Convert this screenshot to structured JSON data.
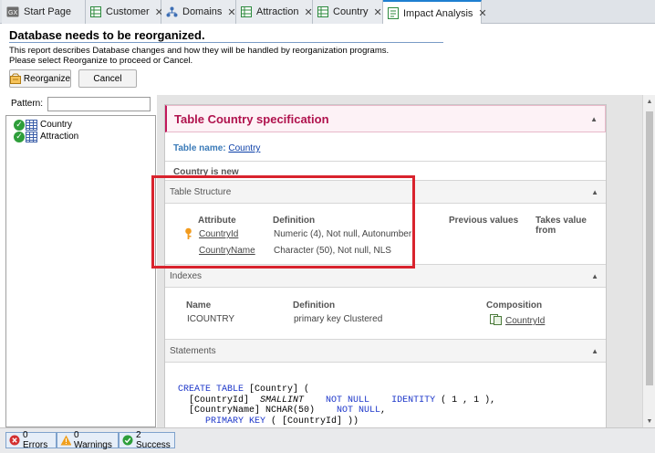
{
  "tabs": [
    {
      "label": "Start Page",
      "icon": "start-page-icon",
      "active": false
    },
    {
      "label": "Customer",
      "icon": "transaction-icon",
      "active": false
    },
    {
      "label": "Domains",
      "icon": "domains-icon",
      "active": false
    },
    {
      "label": "Attraction",
      "icon": "transaction-icon",
      "active": false
    },
    {
      "label": "Country",
      "icon": "transaction-icon",
      "active": false
    },
    {
      "label": "Impact Analysis",
      "icon": "impact-analysis-icon",
      "active": true
    }
  ],
  "header": {
    "title": "Database needs to be reorganized.",
    "desc_line1": "This report describes Database changes and how they will be handled by reorganization programs.",
    "desc_line2": "Please select Reorganize to proceed or Cancel.",
    "reorganize_label": "Reorganize",
    "cancel_label": "Cancel"
  },
  "left": {
    "pattern_label": "Pattern:",
    "pattern_value": "",
    "items": [
      "Country",
      "Attraction"
    ]
  },
  "spec": {
    "title": "Table Country specification",
    "table_name_label": "Table name:",
    "table_name": "Country",
    "status": "Country is new",
    "structure": {
      "title": "Table Structure",
      "headers": {
        "attribute": "Attribute",
        "definition": "Definition",
        "previous": "Previous values",
        "takes": "Takes value from"
      },
      "rows": [
        {
          "attribute": "CountryId",
          "definition": "Numeric (4), Not null, Autonumber",
          "key": true
        },
        {
          "attribute": "CountryName",
          "definition": "Character (50), Not null, NLS",
          "key": false
        }
      ]
    },
    "indexes": {
      "title": "Indexes",
      "headers": {
        "name": "Name",
        "definition": "Definition",
        "composition": "Composition"
      },
      "rows": [
        {
          "name": "ICOUNTRY",
          "definition": "primary key Clustered",
          "composition": "CountryId"
        }
      ]
    },
    "statements": {
      "title": "Statements",
      "lines": [
        "CREATE TABLE [Country] (",
        "  [CountryId]  SMALLINT    NOT NULL    IDENTITY ( 1 , 1 ),",
        "  [CountryName] NCHAR(50)    NOT NULL,",
        "     PRIMARY KEY ( [CountryId] ))"
      ]
    }
  },
  "status": {
    "errors": "0 Errors",
    "warnings": "0 Warnings",
    "success": "2 Success"
  },
  "colors": {
    "accent": "#1e7fd1",
    "spec_title": "#b0124d",
    "highlight": "#d9232d",
    "success": "#2e9e3a",
    "error": "#d32f2f",
    "warning": "#f0a020"
  }
}
